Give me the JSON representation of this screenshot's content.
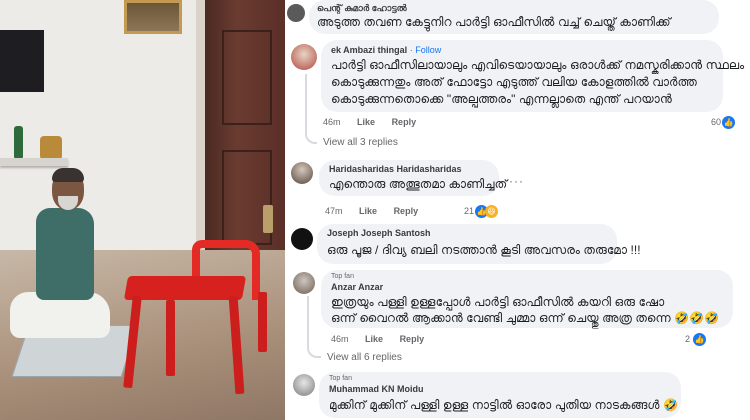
{
  "photo": {
    "description_icon": "photo-icon"
  },
  "comments": [
    {
      "author": "പെന്റ് കുമാർ ഹോട്ടൽ",
      "text": "അടുത്ത തവണ കേട്ടുനിറ പാർട്ടി ഓഫീസിൽ വച്ച് ചെയ്ത് കാണിക്ക്"
    },
    {
      "author": "ek Ambazi thingal",
      "follow": "· Follow",
      "lines": [
        "പാർട്ടി ഓഫീസിലായാലും എവിടെയായാലും ഒരാൾക്ക് നമസ്കരിക്കാൻ സ്ഥലം",
        "കൊടുക്കുന്നതും അത് ഫോട്ടോ എടുത്ത് വലിയ കോളത്തിൽ വാർത്ത",
        "കൊടുക്കുന്നതൊക്കെ \"അല്പത്തരം\" എന്നല്ലാതെ എന്ത് പറയാൻ"
      ],
      "time": "46m",
      "like": "Like",
      "reply": "Reply",
      "reactions": "60",
      "view_replies": "View all 3 replies"
    },
    {
      "author": "Haridasharidas Haridasharidas",
      "text": "എന്തൊരു അത്ഭുതമാ കാണിച്ചത്",
      "time": "47m",
      "like": "Like",
      "reply": "Reply",
      "reactions": "21"
    },
    {
      "author": "Joseph Joseph Santosh",
      "text": "ഒരു പൂജ / ദിവ്യ ബലി നടത്താൻ കൂടി അവസരം തരുമോ !!!"
    },
    {
      "badge": "Top fan",
      "author": "Anzar Anzar",
      "lines": [
        "ഇത്രയും പള്ളി ഉള്ളപ്പോൾ പാർട്ടി ഓഫീസിൽ കയറി ഒരു ഷോ",
        "ഒന്ന് വൈറൽ ആക്കാൻ വേണ്ടി ചുമ്മാ ഒന്ന് ചെയ്തു അത്ര തന്നെ 🤣🤣🤣"
      ],
      "time": "46m",
      "like": "Like",
      "reply": "Reply",
      "reactions": "2",
      "view_replies": "View all 6 replies"
    },
    {
      "badge": "Top fan",
      "author": "Muhammad KN Moidu",
      "text": "മുക്കിന് മുക്കിന് പള്ളി ഉള്ള നാട്ടിൽ ഓരോ പുതിയ നാടകങ്ങൾ 🤣"
    }
  ],
  "colors": {
    "like_blue": "#1877f2",
    "haha_yellow": "#f7b125",
    "bubble_bg": "#f0f2f5"
  }
}
